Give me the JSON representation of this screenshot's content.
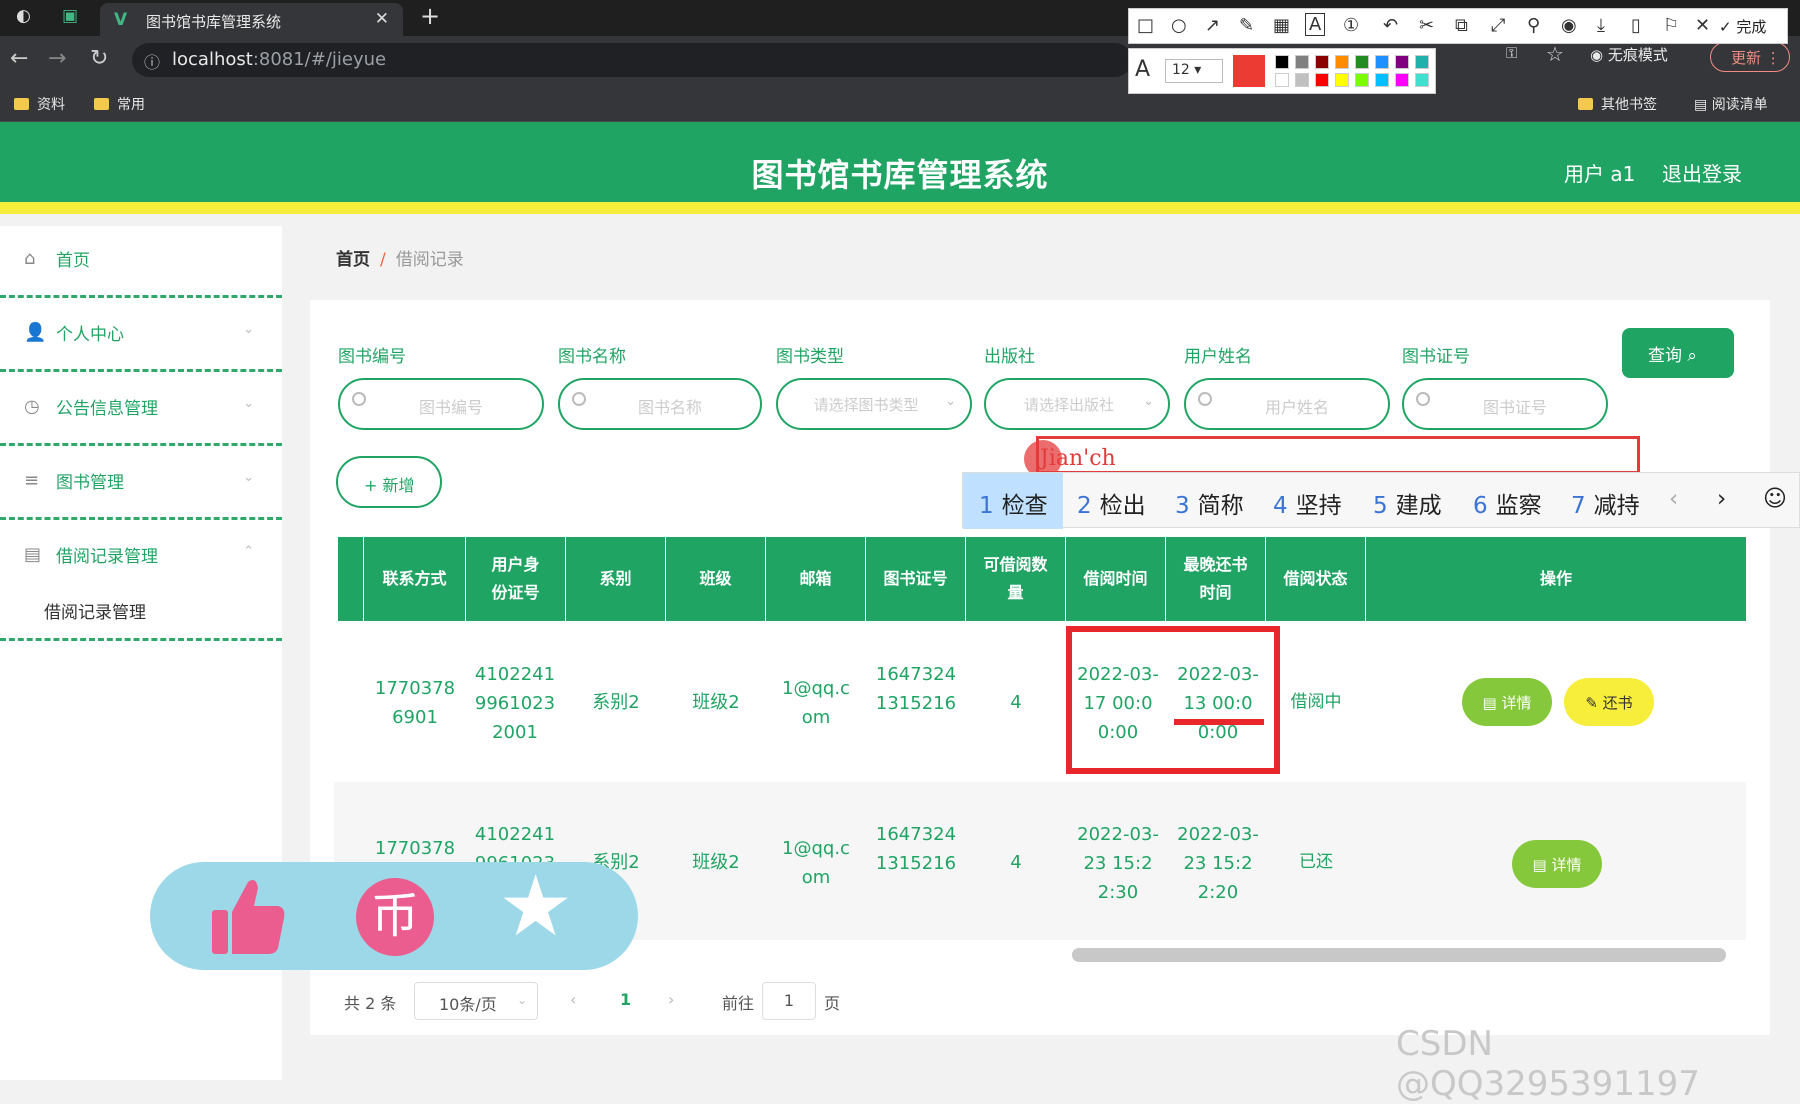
{
  "browser": {
    "tab_title": "图书馆书库管理系统",
    "url_host": "localhost",
    "url_rest": ":8081/#/jieyue",
    "bookmarks": [
      "资料",
      "常用"
    ],
    "bookmarks_right": [
      "其他书签",
      "阅读清单"
    ],
    "incognito_label": "无痕模式",
    "update_label": "更新"
  },
  "snap_toolbar": {
    "done_label": "完成",
    "font_size": "12",
    "colors": [
      "#000000",
      "#808080",
      "#8b0000",
      "#ff8c00",
      "#228b22",
      "#1e90ff",
      "#800080",
      "#20b2aa",
      "#ffffff",
      "#c0c0c0",
      "#ff0000",
      "#ffff00",
      "#7cfc00",
      "#00bfff",
      "#ff00ff",
      "#40e0d0"
    ]
  },
  "app": {
    "title": "图书馆书库管理系统",
    "user_label": "用户 a1",
    "logout_label": "退出登录"
  },
  "sidebar": {
    "items": [
      {
        "label": "首页",
        "icon": "home-icon"
      },
      {
        "label": "个人中心",
        "icon": "user-icon"
      },
      {
        "label": "公告信息管理",
        "icon": "clock-icon"
      },
      {
        "label": "图书管理",
        "icon": "menu-icon"
      },
      {
        "label": "借阅记录管理",
        "icon": "trash-icon"
      }
    ],
    "sub_item": "借阅记录管理"
  },
  "breadcrumb": {
    "home": "首页",
    "sep": "/",
    "current": "借阅记录"
  },
  "filters": [
    {
      "label": "图书编号",
      "placeholder": "图书编号"
    },
    {
      "label": "图书名称",
      "placeholder": "图书名称"
    },
    {
      "label": "图书类型",
      "placeholder": "请选择图书类型"
    },
    {
      "label": "出版社",
      "placeholder": "请选择出版社"
    },
    {
      "label": "用户姓名",
      "placeholder": "用户姓名"
    },
    {
      "label": "图书证号",
      "placeholder": "图书证号"
    }
  ],
  "query_button": "查询",
  "add_button": "+ 新增",
  "ime": {
    "composition": "Jian'ch",
    "candidates": [
      "检查",
      "检出",
      "简称",
      "坚持",
      "建成",
      "监察",
      "减持"
    ]
  },
  "table": {
    "columns": [
      "联系方式",
      "用户身份证号",
      "系别",
      "班级",
      "邮箱",
      "图书证号",
      "可借阅数量",
      "借阅时间",
      "最晚还书时间",
      "借阅状态",
      "操作"
    ],
    "rows": [
      {
        "phone": "17703786901",
        "id_card": "410224199610232001",
        "dept": "系别2",
        "class": "班级2",
        "email": "1@qq.com",
        "card_no": "16473241315216",
        "quantity": "4",
        "borrow_time": "2022-03-17 00:00:00",
        "due_time": "2022-03-13 00:00:00",
        "status": "借阅中",
        "actions": [
          "详情",
          "还书"
        ]
      },
      {
        "phone": "17703786901",
        "id_card": "410224199610232001",
        "dept": "系别2",
        "class": "班级2",
        "email": "1@qq.com",
        "card_no": "16473241315216",
        "quantity": "4",
        "borrow_time": "2022-03-23 15:22:30",
        "due_time": "2022-03-23 15:22:20",
        "status": "已还",
        "actions": [
          "详情"
        ]
      }
    ]
  },
  "pagination": {
    "total": "共 2 条",
    "page_size": "10条/页",
    "current_page": "1",
    "goto_label": "前往",
    "goto_value": "1",
    "page_suffix": "页"
  },
  "watermark": "CSDN @QQ3295391197"
}
